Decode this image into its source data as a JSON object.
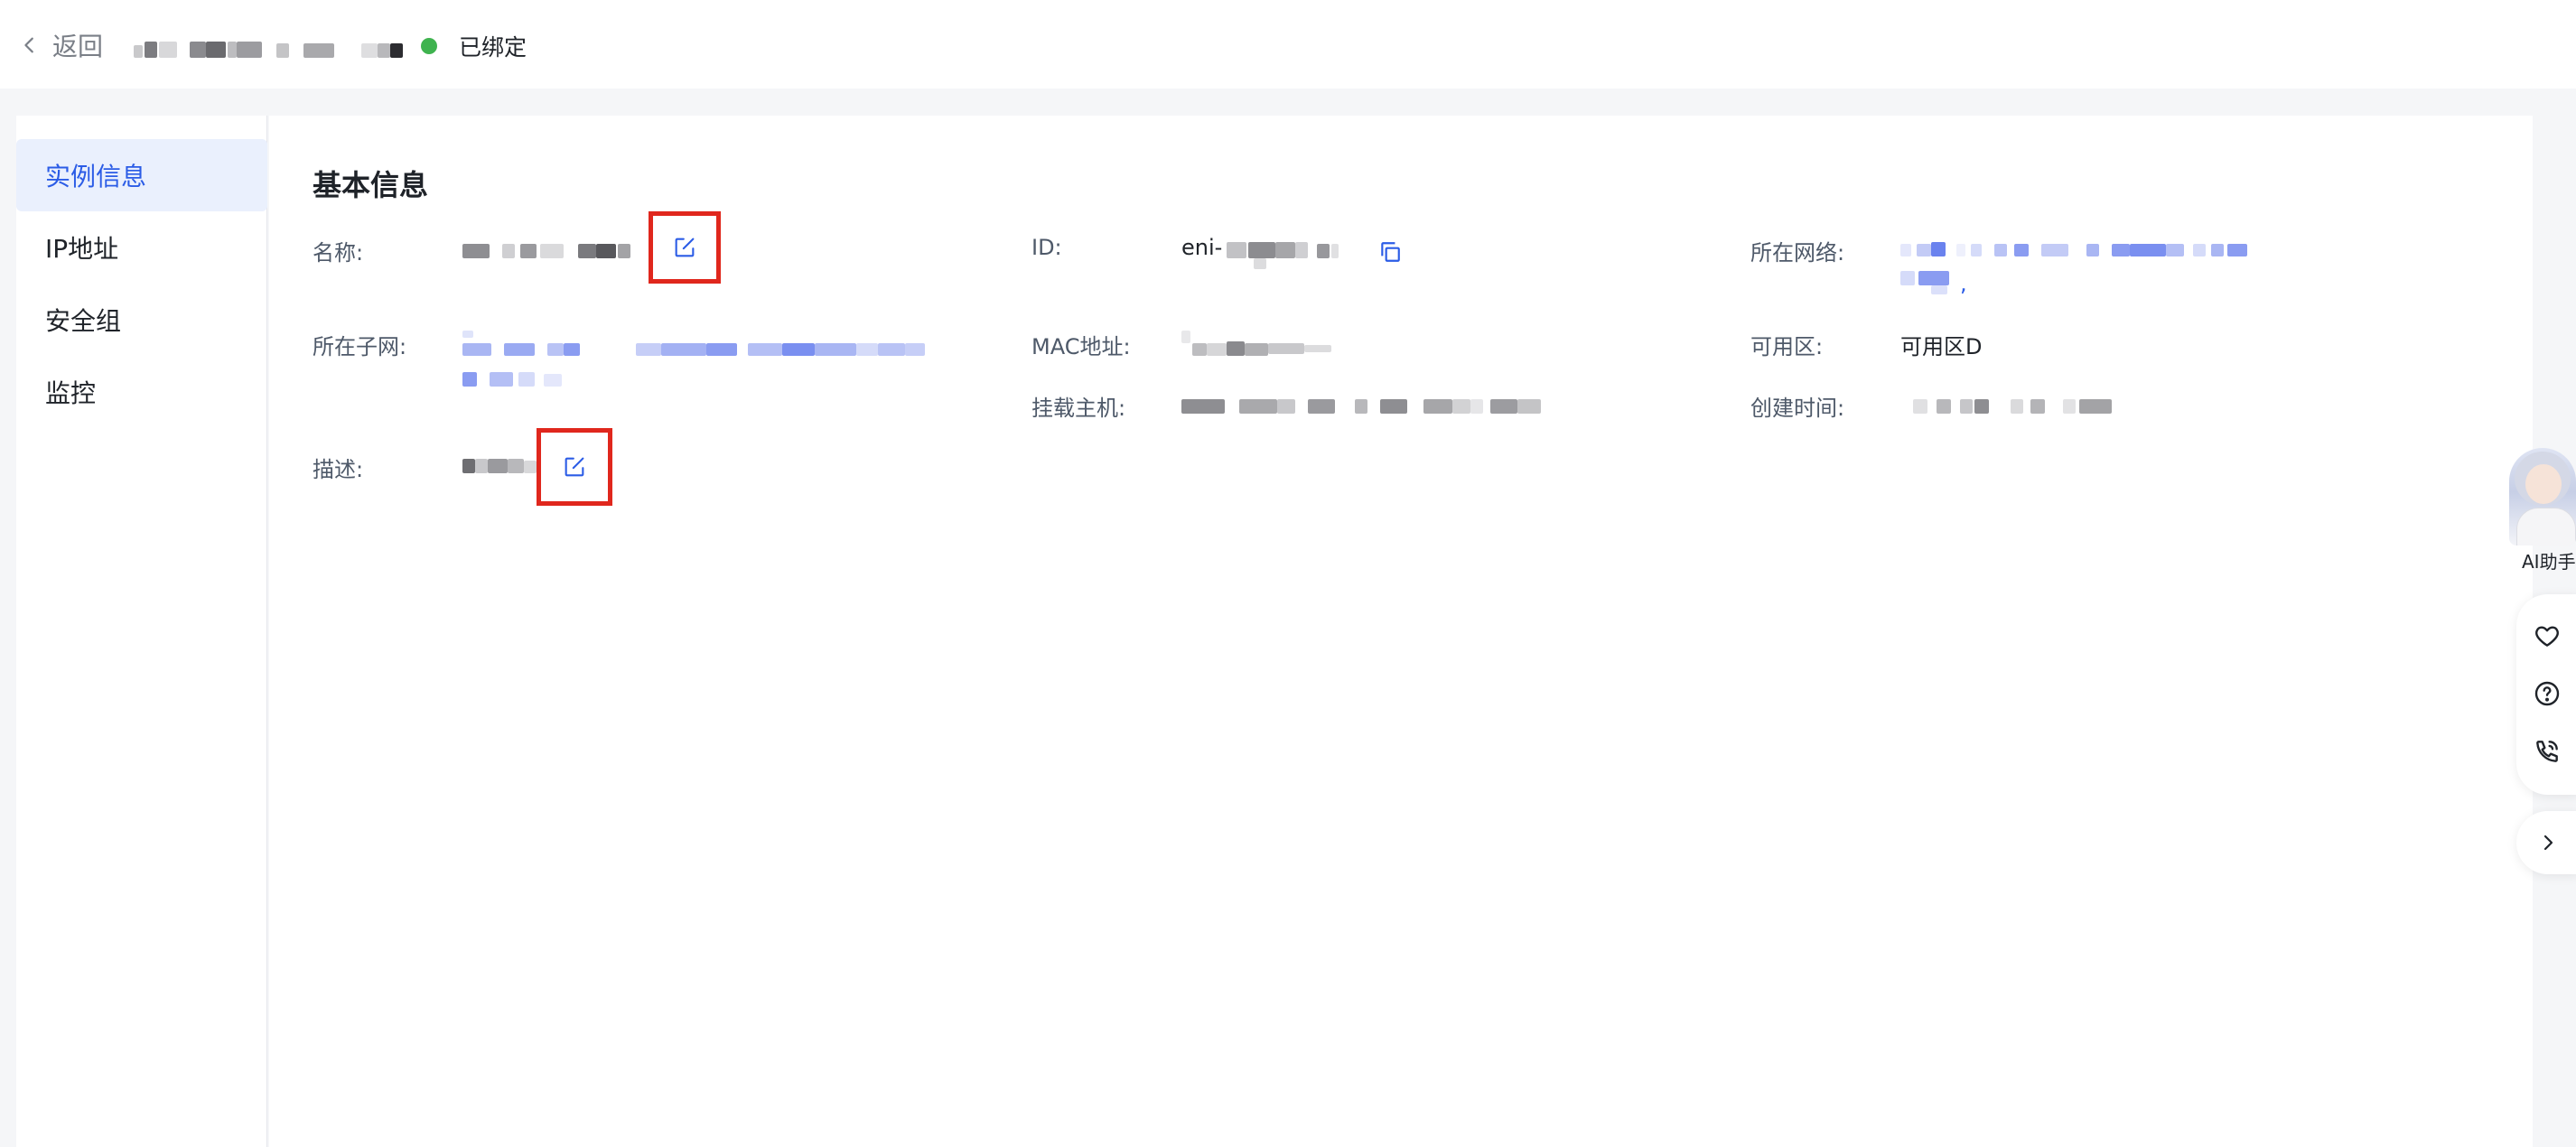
{
  "header": {
    "back_label": "返回",
    "status_text": "已绑定",
    "status_color": "#3fb34f"
  },
  "sidebar": {
    "items": [
      {
        "label": "实例信息",
        "active": true
      },
      {
        "label": "IP地址",
        "active": false
      },
      {
        "label": "安全组",
        "active": false
      },
      {
        "label": "监控",
        "active": false
      }
    ]
  },
  "basic_info": {
    "title": "基本信息",
    "name_label": "名称:",
    "id_label": "ID:",
    "id_prefix": "eni-",
    "network_label": "所在网络:",
    "network_suffix": ",",
    "subnet_label": "所在子网:",
    "mac_label": "MAC地址:",
    "zone_label": "可用区:",
    "zone_value": "可用区D",
    "host_label": "挂载主机:",
    "created_label": "创建时间:",
    "desc_label": "描述:"
  },
  "assistant": {
    "label": "AI助手"
  },
  "icons": {
    "back": "chevron-left-icon",
    "edit": "edit-icon",
    "copy": "copy-icon",
    "favorite": "heart-icon",
    "help": "question-icon",
    "phone": "phone-icon",
    "collapse": "chevron-right-icon"
  },
  "colors": {
    "accent": "#2b5ce6",
    "highlight_box": "#e0271d",
    "active_bg": "#eaf0fd"
  }
}
